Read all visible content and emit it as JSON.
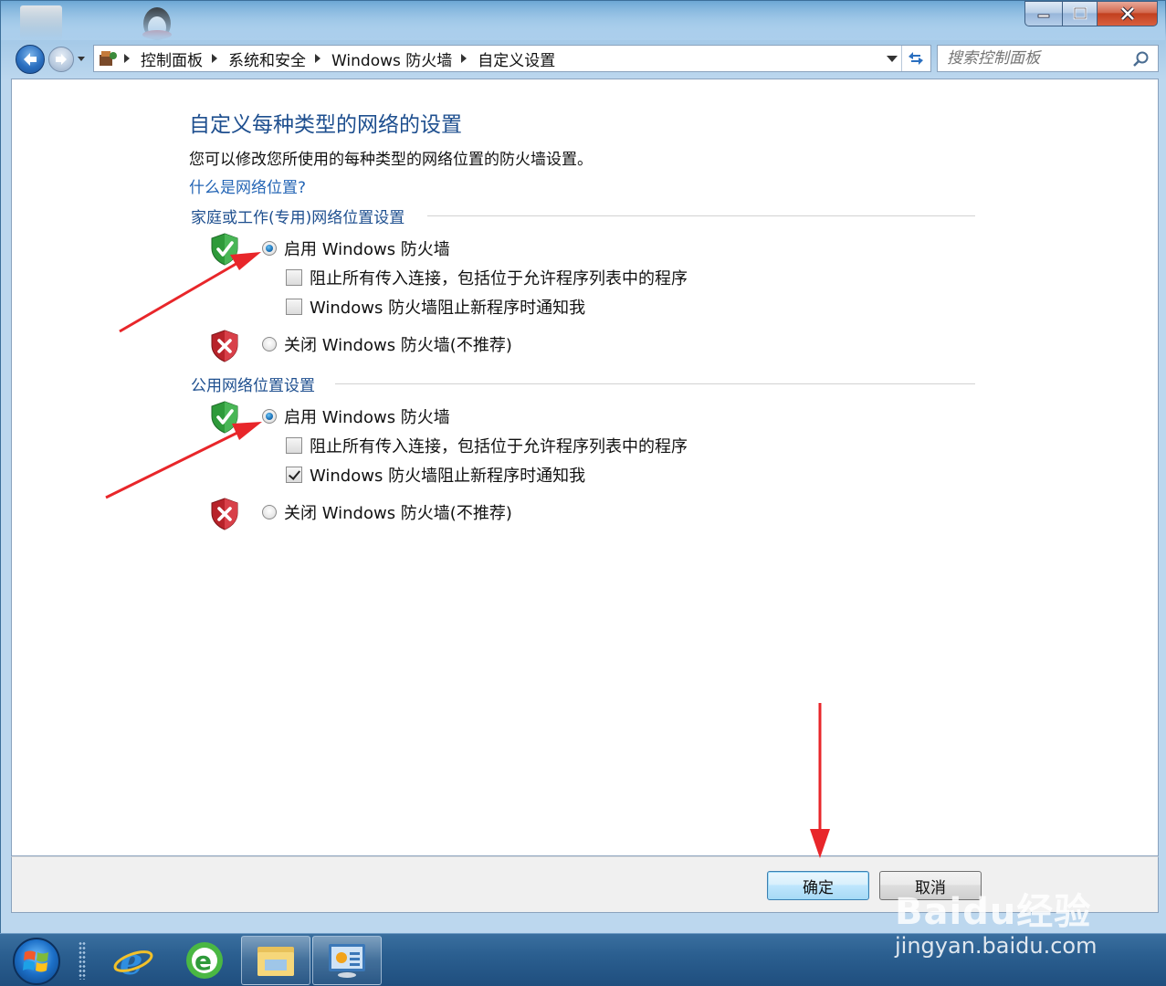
{
  "breadcrumbs": [
    "控制面板",
    "系统和安全",
    "Windows 防火墙",
    "自定义设置"
  ],
  "search": {
    "placeholder": "搜索控制面板"
  },
  "page": {
    "title": "自定义每种类型的网络的设置",
    "description": "您可以修改您所使用的每种类型的网络位置的防火墙设置。",
    "help_link": "什么是网络位置?"
  },
  "sections": [
    {
      "label": "家庭或工作(专用)网络位置设置",
      "enable_label": "启用 Windows 防火墙",
      "enable_selected": true,
      "block_all_label": "阻止所有传入连接，包括位于允许程序列表中的程序",
      "block_all_checked": false,
      "notify_label": "Windows 防火墙阻止新程序时通知我",
      "notify_checked": false,
      "disable_label": "关闭 Windows 防火墙(不推荐)",
      "disable_selected": false
    },
    {
      "label": "公用网络位置设置",
      "enable_label": "启用 Windows 防火墙",
      "enable_selected": true,
      "block_all_label": "阻止所有传入连接，包括位于允许程序列表中的程序",
      "block_all_checked": false,
      "notify_label": "Windows 防火墙阻止新程序时通知我",
      "notify_checked": true,
      "disable_label": "关闭 Windows 防火墙(不推荐)",
      "disable_selected": false
    }
  ],
  "footer": {
    "ok_label": "确定",
    "cancel_label": "取消"
  },
  "watermark": {
    "logo": "Baidu经验",
    "url": "jingyan.baidu.com"
  },
  "colors": {
    "title_blue": "#1e4f8f",
    "link_blue": "#2465b5",
    "annotation_red": "#e8262a"
  },
  "taskbar": {
    "items": [
      "start-orb",
      "internet-explorer-icon",
      "update-icon",
      "file-explorer-icon",
      "control-panel-icon"
    ]
  }
}
